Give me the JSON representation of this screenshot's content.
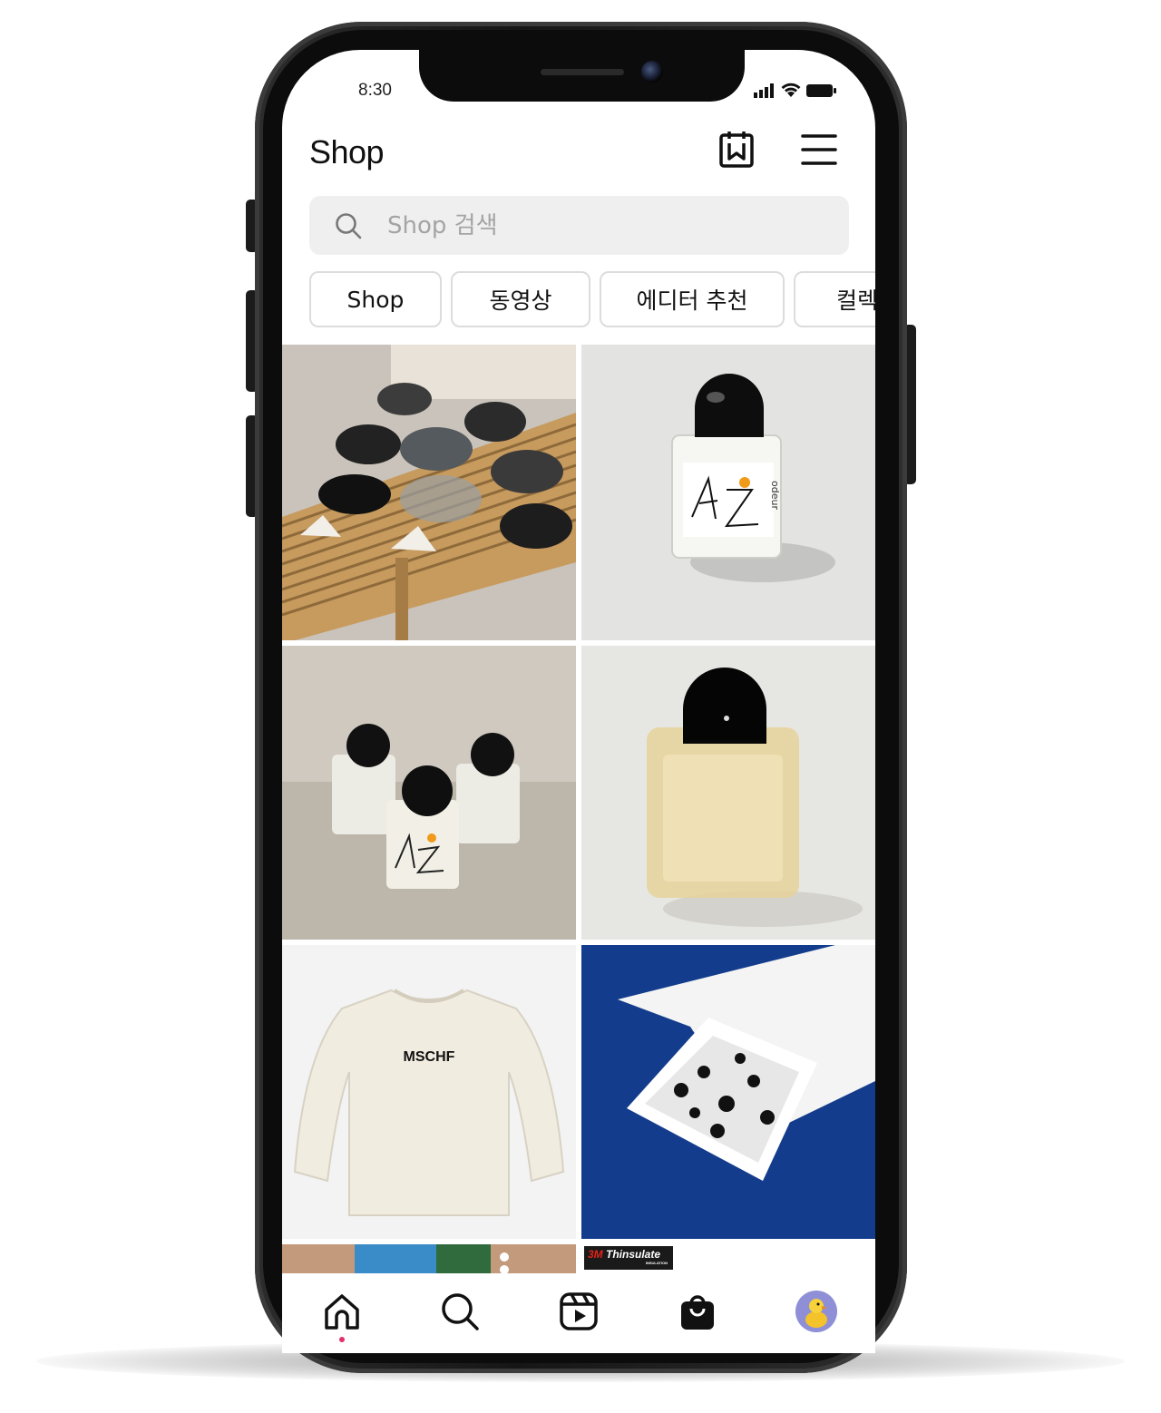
{
  "status_bar": {
    "time": "8:30"
  },
  "header": {
    "title": "Shop"
  },
  "search": {
    "placeholder": "Shop 검색",
    "value": ""
  },
  "chips": [
    {
      "label": "Shop"
    },
    {
      "label": "동영상"
    },
    {
      "label": "에디터 추천"
    },
    {
      "label": "컬렉"
    }
  ],
  "posts": [
    {
      "text": ""
    },
    {
      "text": "odeur"
    },
    {
      "text": ""
    },
    {
      "text": ""
    },
    {
      "text": "MSCHF"
    },
    {
      "text": ""
    },
    {
      "text": ""
    },
    {
      "text": "Thinsulate",
      "badge_prefix": "3M",
      "badge_sub": "INSULATION"
    }
  ],
  "nav": {
    "active": "home"
  },
  "colors": {
    "search_bg": "#efefef",
    "active_dot": "#e1306c",
    "product_bg_blue": "#143c8c"
  }
}
